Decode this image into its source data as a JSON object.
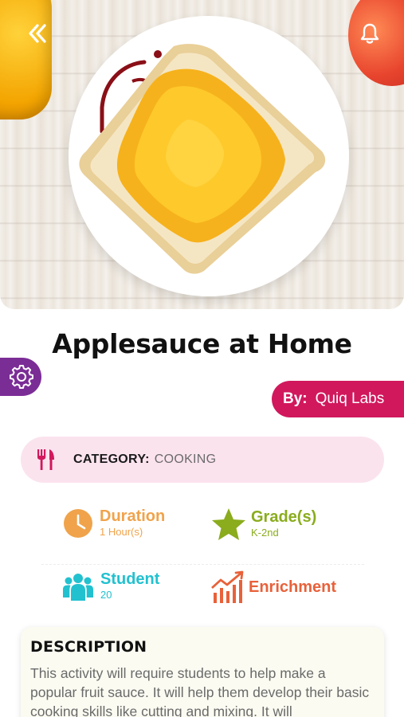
{
  "hero": {
    "back_icon": "double-chevron-left-icon",
    "bell_icon": "bell-icon",
    "image_subject": "toast"
  },
  "activity": {
    "title": "Applesauce at Home",
    "author_prefix": "By:",
    "author_name": "Quiq Labs"
  },
  "category": {
    "icon": "fork-knife-icon",
    "label": "CATEGORY:",
    "value": "COOKING"
  },
  "details": {
    "duration": {
      "label": "Duration",
      "value": "1 Hour(s)",
      "icon": "clock-icon",
      "color": "#f0a34b"
    },
    "grades": {
      "label": "Grade(s)",
      "value": "K-2nd",
      "icon": "star-icon",
      "color": "#8aac1d"
    },
    "student": {
      "label": "Student",
      "value": "20",
      "icon": "group-icon",
      "color": "#22c1cf"
    },
    "type": {
      "label": "Enrichment",
      "icon": "chart-icon",
      "color": "#e8613a"
    }
  },
  "description": {
    "heading": "DESCRIPTION",
    "text": "This activity will require students to help make a popular fruit sauce. It will help them develop their basic cooking skills like cutting and mixing. It will"
  },
  "colors": {
    "accent_pink": "#d1185d",
    "settings_purple": "#7b2d96",
    "category_bg": "#fbe3ee"
  }
}
